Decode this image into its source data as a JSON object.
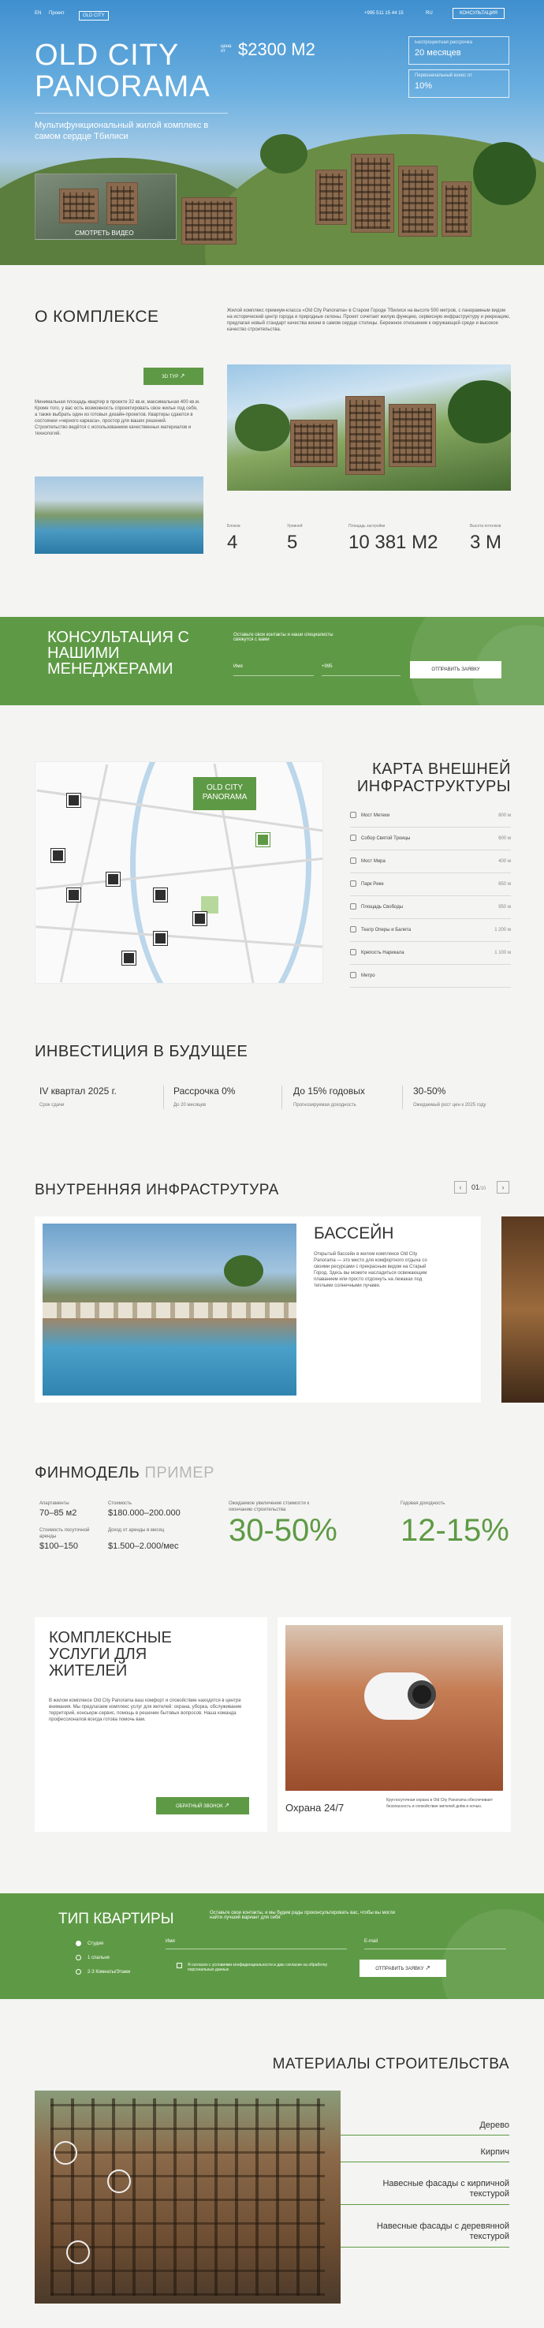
{
  "header": {
    "logo_small": "EN",
    "nav_small": "Проект",
    "brand": "OLD CITY",
    "phone": "+995 511 15 44 15",
    "lang": "RU",
    "cta": "КОНСУЛЬТАЦИЯ"
  },
  "hero": {
    "title": "OLD CITY PANORAMA",
    "price_label": "цена от",
    "price": "$2300 M2",
    "subtitle": "Мультифункциональный жилой комплекс в самом сердце Тбилиси",
    "boxes": [
      {
        "label": "Беспроцентная рассрочка",
        "value": "20 месяцев"
      },
      {
        "label": "Первоначальный взнос от",
        "value": "10%"
      }
    ],
    "video_label": "СМОТРЕТЬ ВИДЕО"
  },
  "about": {
    "title": "О КОМПЛЕКСЕ",
    "text_right": "Жилой комплекс премиум-класса «Old City Panorama» в Старом Городе Тбилиси на высоте 500 метров, с панорамным видом на исторический центр города и природные склоны. Проект сочетает жилую функцию, сервисную инфраструктуру и рекреацию, предлагая новый стандарт качества жизни в самом сердце столицы. Бережное отношение к окружающей среде и высокое качество строительства.",
    "tour_button": "3D ТУР",
    "text_left": "Минимальная площадь квартир в проекте 32 кв.м, максимальная 400 кв.м. Кроме того, у вас есть возможность спроектировать свое жилье под себя, а также выбрать один из готовых дизайн-проектов. Квартиры сдаются в состоянии «черного каркаса», простор для ваших решений. Строительство ведётся с использованием качественных материалов и технологий.",
    "stats": [
      {
        "label": "Блоков",
        "value": "4"
      },
      {
        "label": "Уровней",
        "value": "5"
      },
      {
        "label": "Площадь застройки",
        "value": "10 381 M2"
      },
      {
        "label": "Высота потолков",
        "value": "3 M"
      }
    ]
  },
  "consult": {
    "title": "КОНСУЛЬТАЦИЯ С НАШИМИ МЕНЕДЖЕРАМИ",
    "subtitle": "Оставьте свои контакты и наши специалисты свяжутся с вами",
    "name_placeholder": "Имя",
    "phone_placeholder": "+995",
    "button": "ОТПРАВИТЬ ЗАЯВКУ"
  },
  "map": {
    "title": "КАРТА ВНЕШНЕЙ ИНФРАСТРУКТУРЫ",
    "label": "OLD CITY PANORAMA",
    "items": [
      {
        "name": "Мост Метехи",
        "dist": "800 м"
      },
      {
        "name": "Собор Святой Троицы",
        "dist": "600 м"
      },
      {
        "name": "Мост Мира",
        "dist": "400 м"
      },
      {
        "name": "Парк Рике",
        "dist": "650 м"
      },
      {
        "name": "Площадь Свободы",
        "dist": "950 м"
      },
      {
        "name": "Театр Оперы и Балета",
        "dist": "1 200 м"
      },
      {
        "name": "Крепость Нарикала",
        "dist": "1 100 м"
      },
      {
        "name": "Метро",
        "dist": ""
      }
    ]
  },
  "invest": {
    "title": "ИНВЕСТИЦИЯ В БУДУЩЕЕ",
    "items": [
      {
        "value": "IV квартал 2025 г.",
        "label": "Срок сдачи"
      },
      {
        "value": "Рассрочка 0%",
        "label": "До 20 месяцев"
      },
      {
        "value": "До 15% годовых",
        "label": "Прогнозируемая доходность"
      },
      {
        "value": "30-50%",
        "label": "Ожидаемый рост цен к 2025 году"
      }
    ]
  },
  "inner": {
    "title": "ВНУТРЕННЯЯ ИНФРАСТРУТУРА",
    "counter": "01",
    "counter_total": "/10",
    "card_title": "БАССЕЙН",
    "card_text": "Открытый бассейн в жилом комплексе Old City Panorama — это место для комфортного отдыха со своими ресурсами с прекрасным видом на Старый Город. Здесь вы можете насладиться освежающим плаванием или просто отдохнуть на лежаках под теплыми солнечными лучами."
  },
  "fin": {
    "title_a": "ФИНМОДЕЛЬ",
    "title_b": "ПРИМЕР",
    "cells": [
      {
        "label": "Апартаменты",
        "value": "70–85 м2"
      },
      {
        "label": "Стоимость",
        "value": "$180.000–200.000"
      },
      {
        "label": "Стоимость посуточной аренды",
        "value": "$100–150"
      },
      {
        "label": "Доход от аренды в месяц",
        "value": "$1.500–2.000/мес"
      }
    ],
    "big1_label": "Ожидаемое увеличение стоимости к окончанию строительства",
    "big1": "30-50%",
    "big2_label": "Годовая доходность",
    "big2": "12-15%"
  },
  "services": {
    "title": "КОМПЛЕКСНЫЕ УСЛУГИ ДЛЯ ЖИТЕЛЕЙ",
    "text": "В жилом комплексе Old City Panorama ваш комфорт и спокойствие находятся в центре внимания. Мы предлагаем комплекс услуг для жителей: охрана, уборка, обслуживание территорий, консьерж-сервис, помощь в решении бытовых вопросов. Наша команда профессионалов всегда готова помочь вам.",
    "button": "ОБРАТНЫЙ ЗВОНОК",
    "card_title": "Охрана 24/7",
    "card_text": "Круглосуточная охрана в Old City Panorama обеспечивает безопасность и спокойствие жителей днём и ночью."
  },
  "apt_type": {
    "title": "ТИП КВАРТИРЫ",
    "subtitle": "Оставьте свои контакты, и мы будем рады проконсультировать вас, чтобы вы могли найти лучший вариант для себя",
    "options": [
      "Студия",
      "1 спальня",
      "2-3 Комнаты/Этажи"
    ],
    "name_placeholder": "Имя",
    "email_placeholder": "E-mail",
    "consent": "Я согласен с условиями конфиденциальности и даю согласие на обработку персональных данных",
    "button": "ОТПРАВИТЬ ЗАЯВКУ"
  },
  "materials": {
    "title": "МАТЕРИАЛЫ СТРОИТЕЛЬСТВА",
    "items": [
      "Дерево",
      "Кирпич",
      "Навесные фасады с кирпичной текстурой",
      "Навесные фасады с деревянной текстурой"
    ]
  },
  "colors": {
    "accent": "#5e9a45",
    "bg": "#f4f4f2"
  }
}
